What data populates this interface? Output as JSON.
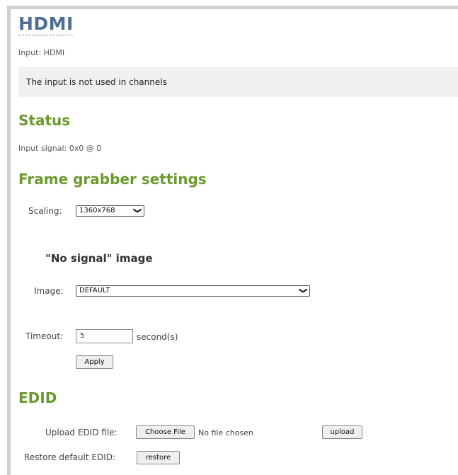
{
  "header": {
    "title": "HDMI",
    "input_line": "Input: HDMI"
  },
  "notice": {
    "text": "The input is not used in channels"
  },
  "status": {
    "heading": "Status",
    "signal_line": "Input signal: 0x0 @ 0"
  },
  "frame_grabber": {
    "heading": "Frame grabber settings",
    "scaling_label": "Scaling:",
    "scaling_value": "1360x768",
    "no_signal_heading": "\"No signal\" image",
    "image_label": "Image:",
    "image_value": "DEFAULT",
    "timeout_label": "Timeout:",
    "timeout_value": "5",
    "timeout_unit": "second(s)",
    "apply_label": "Apply"
  },
  "edid": {
    "heading": "EDID",
    "upload_label": "Upload EDID file:",
    "choose_file_label": "Choose File",
    "no_file_text": "No file chosen",
    "upload_button_label": "upload",
    "restore_label": "Restore default EDID:",
    "restore_button_label": "restore"
  },
  "icons": {
    "dropdown": "chevron-down-icon"
  }
}
